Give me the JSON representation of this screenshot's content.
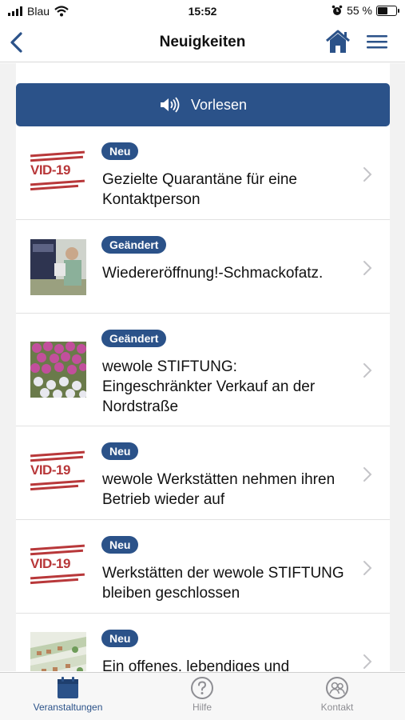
{
  "status_bar": {
    "carrier": "Blau",
    "time": "15:52",
    "battery_percent": "55 %",
    "battery_level": 0.55
  },
  "nav": {
    "title": "Neuigkeiten",
    "back_icon": "chevron-left-icon",
    "home_icon": "home-icon",
    "menu_icon": "hamburger-menu-icon"
  },
  "read_aloud": {
    "label": "Vorlesen",
    "icon": "speaker-icon"
  },
  "covid_stamp_text": "VID-19",
  "news": [
    {
      "badge": "Neu",
      "title": "Gezielte Quarantäne für eine Kontaktperson",
      "thumb": "covid-stamp"
    },
    {
      "badge": "Geändert",
      "title": "Wiedereröffnung!-Schmackofatz.",
      "thumb": "photo-people"
    },
    {
      "badge": "Geändert",
      "title": "wewole STIFTUNG: Eingeschränkter Verkauf an der Nordstraße",
      "thumb": "photo-flowers"
    },
    {
      "badge": "Neu",
      "title": "wewole Werkstätten nehmen ihren Betrieb wieder auf",
      "thumb": "covid-stamp"
    },
    {
      "badge": "Neu",
      "title": "Werkstätten der wewole STIFTUNG bleiben geschlossen",
      "thumb": "covid-stamp"
    },
    {
      "badge": "Neu",
      "title": "Ein offenes, lebendiges und",
      "thumb": "photo-map"
    }
  ],
  "tabs": [
    {
      "label": "Veranstaltungen",
      "icon": "calendar-icon",
      "active": true
    },
    {
      "label": "Hilfe",
      "icon": "help-icon",
      "active": false
    },
    {
      "label": "Kontakt",
      "icon": "contact-icon",
      "active": false
    }
  ],
  "colors": {
    "accent": "#2b5289",
    "inactive": "#8e8e93",
    "stamp_red": "#b8383a"
  }
}
